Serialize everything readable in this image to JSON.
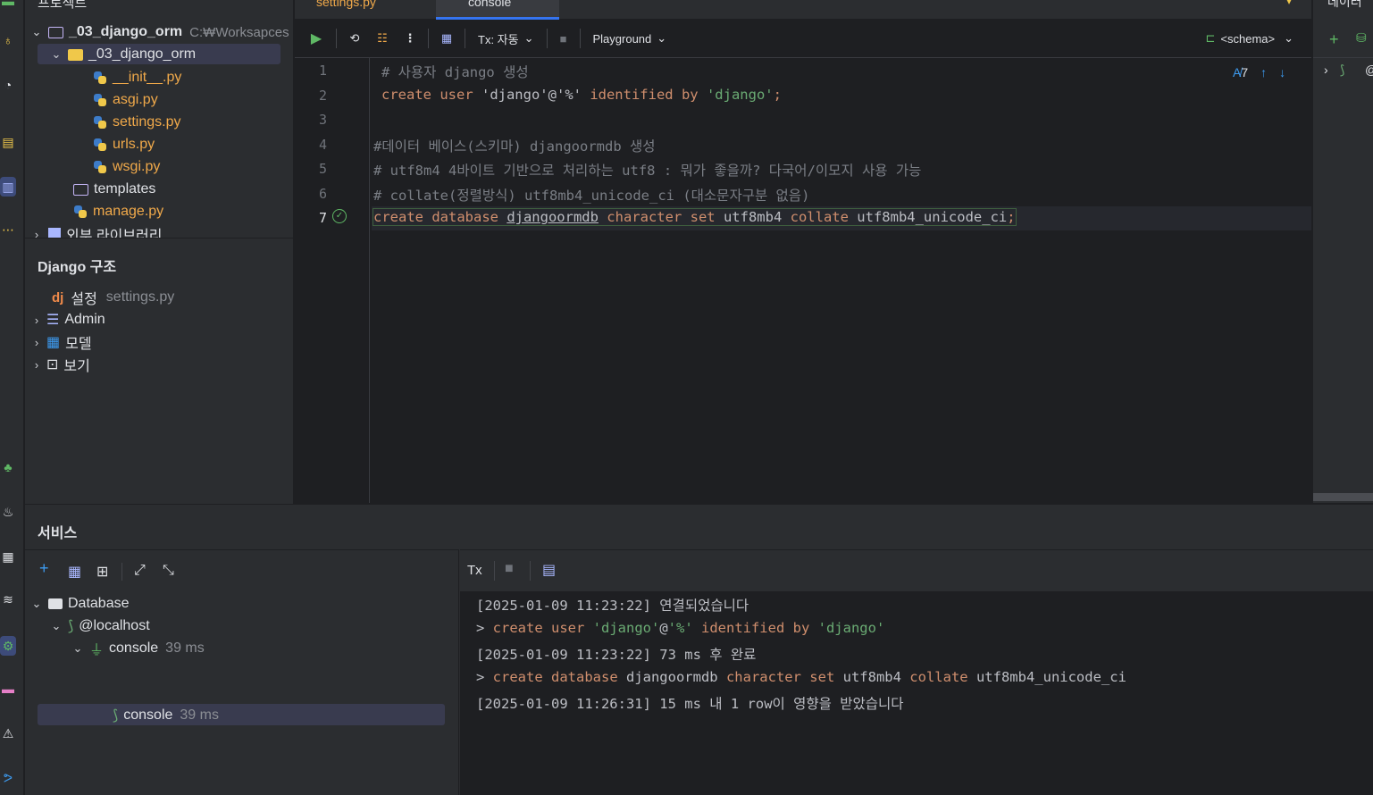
{
  "project": {
    "root_name": "_03_django_orm",
    "root_path": "C:₩Worksapces",
    "package_name": "_03_django_orm",
    "files": [
      "__init__.py",
      "asgi.py",
      "settings.py",
      "urls.py",
      "wsgi.py"
    ],
    "templates_folder": "templates",
    "manage_file": "manage.py",
    "external_libs": "외부 라이브러리"
  },
  "django_panel": {
    "title": "Django 구조",
    "settings_label": "설정",
    "settings_file": "settings.py",
    "items": [
      "Admin",
      "모델",
      "보기"
    ],
    "dj_badge": "dj"
  },
  "editor": {
    "tabs": [
      "settings.py",
      "console"
    ],
    "toolbar": {
      "tx_label": "Tx: 자동",
      "playground_label": "Playground",
      "schema_label": "<schema>"
    },
    "inspection_count": "7",
    "line_numbers": [
      "1",
      "2",
      "3",
      "4",
      "5",
      "6",
      "7"
    ],
    "lines": {
      "l1": "# 사용자 django 생성",
      "l2_kw1": "create user ",
      "l2_str1": "'django'",
      "l2_at": "@",
      "l2_str2": "'%'",
      "l2_kw2": " identified by ",
      "l2_str3": "'django'",
      "l2_end": ";",
      "l4": "#데이터 베이스(스키마) djangoormdb 생성",
      "l5": "# utf8m4 4바이트 기반으로 처리하는 utf8 : 뭐가 좋을까? 다국어/이모지 사용 가능",
      "l6": "# collate(정렬방식) utf8mb4_unicode_ci (대소문자구분 없음)",
      "l7_kw1": "create database ",
      "l7_name": "djangoormdb",
      "l7_kw2": " character set ",
      "l7_cs": "utf8mb4",
      "l7_kw3": " collate ",
      "l7_coll": "utf8mb4_unicode_ci",
      "l7_end": ";"
    }
  },
  "services": {
    "title": "서비스",
    "tree": {
      "database": "Database",
      "host": "@localhost",
      "console_parent": "console",
      "console_parent_time": "39 ms",
      "console_child": "console",
      "console_child_time": "39 ms"
    },
    "output_toolbar": {
      "tx": "Tx"
    },
    "output": {
      "o1": "[2025-01-09 11:23:22] 연결되었습니다",
      "o2_prompt": "> ",
      "o2_kw1": "create user ",
      "o2_str1": "'django'",
      "o2_at": "@",
      "o2_str2": "'%'",
      "o2_kw2": " identified by ",
      "o2_str3": "'django'",
      "o3": "[2025-01-09 11:23:22] 73 ms 후 완료",
      "o4_prompt": "> ",
      "o4_kw1": "create database ",
      "o4_name": "djangoormdb",
      "o4_kw2": " character set ",
      "o4_cs": "utf8mb4",
      "o4_kw3": " collate ",
      "o4_coll": "utf8mb4_unicode_ci",
      "o5": "[2025-01-09 11:26:31] 15 ms 내 1 row이 영향을 받았습니다"
    }
  },
  "colors": {
    "background": "#1e1f22",
    "panel": "#2b2d30",
    "keyword": "#cf8e6d",
    "string": "#6aab73",
    "comment": "#7a7e85",
    "accent": "#3574f0",
    "run_green": "#5fb865"
  }
}
